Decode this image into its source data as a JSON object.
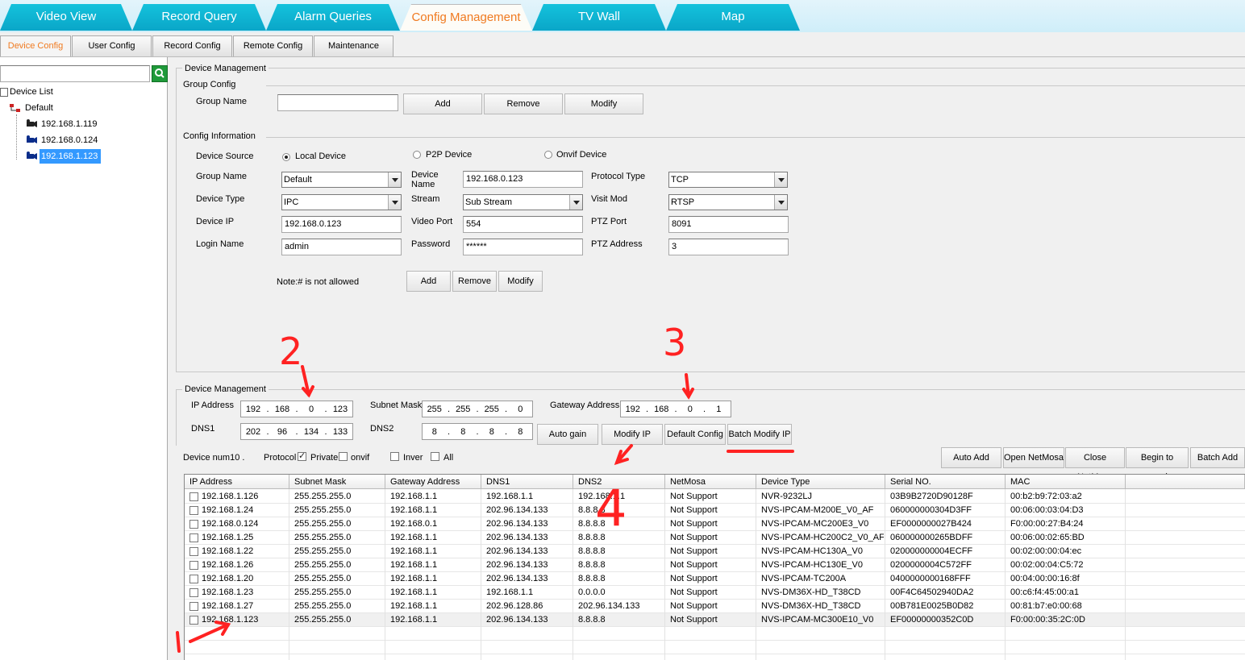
{
  "top_tabs": [
    "Video View",
    "Record Query",
    "Alarm Queries",
    "Config Management",
    "TV Wall",
    "Map"
  ],
  "sub_tabs": [
    "Device Config",
    "User Config",
    "Record Config",
    "Remote Config",
    "Maintenance"
  ],
  "tree": {
    "root": "Device List",
    "group": "Default",
    "devices": [
      "192.168.1.119",
      "192.168.0.124",
      "192.168.1.123"
    ]
  },
  "device_management_title": "Device Management",
  "group_config": {
    "title": "Group Config",
    "group_name_label": "Group Name",
    "group_name_value": "",
    "add": "Add",
    "remove": "Remove",
    "modify": "Modify"
  },
  "config_info": {
    "title": "Config Information",
    "device_source_label": "Device Source",
    "sources": [
      "Local Device",
      "P2P Device",
      "Onvif Device"
    ],
    "group_name_label": "Group Name",
    "group_name": "Default",
    "device_name_label": "Device Name",
    "device_name": "192.168.0.123",
    "protocol_type_label": "Protocol Type",
    "protocol_type": "TCP",
    "device_type_label": "Device Type",
    "device_type": "IPC",
    "stream_label": "Stream",
    "stream": "Sub Stream",
    "visit_mod_label": "Visit Mod",
    "visit_mod": "RTSP",
    "device_ip_label": "Device IP",
    "device_ip": "192.168.0.123",
    "video_port_label": "Video Port",
    "video_port": "554",
    "ptz_port_label": "PTZ Port",
    "ptz_port": "8091",
    "login_name_label": "Login Name",
    "login_name": "admin",
    "password_label": "Password",
    "password": "******",
    "ptz_address_label": "PTZ Address",
    "ptz_address": "3",
    "note": "Note:# is not allowed",
    "add": "Add",
    "remove": "Remove",
    "modify": "Modify"
  },
  "net": {
    "title": "Device Management",
    "ip_label": "IP Address",
    "ip": [
      "192",
      "168",
      "0",
      "123"
    ],
    "mask_label": "Subnet Mask",
    "mask": [
      "255",
      "255",
      "255",
      "0"
    ],
    "gw_label": "Gateway Address",
    "gw": [
      "192",
      "168",
      "0",
      "1"
    ],
    "dns1_label": "DNS1",
    "dns1": [
      "202",
      "96",
      "134",
      "133"
    ],
    "dns2_label": "DNS2",
    "dns2": [
      "8",
      "8",
      "8",
      "8"
    ],
    "auto_gain": "Auto gain",
    "modify_ip": "Modify IP",
    "default_config": "Default Config",
    "batch_modify_ip": "Batch Modify IP",
    "device_num": "Device num10 .",
    "protocol_label": "Protocol",
    "private_label": "Private",
    "onvif_label": "onvif",
    "inver_label": "Inver",
    "all_label": "All",
    "auto_add": "Auto Add",
    "open_netmosa": "Open NetMosa",
    "close_netmosa": "Close NetMosa",
    "begin_search": "Begin to search",
    "batch_add": "Batch Add"
  },
  "table": {
    "headers": [
      "IP Address",
      "Subnet Mask",
      "Gateway Address",
      "DNS1",
      "DNS2",
      "NetMosa",
      "Device Type",
      "Serial NO.",
      "MAC"
    ],
    "rows": [
      [
        "192.168.1.126",
        "255.255.255.0",
        "192.168.1.1",
        "192.168.1.1",
        "192.168.1.1",
        "Not Support",
        "NVR-9232LJ",
        "03B9B2720D90128F",
        "00:b2:b9:72:03:a2"
      ],
      [
        "192.168.1.24",
        "255.255.255.0",
        "192.168.1.1",
        "202.96.134.133",
        "8.8.8.8",
        "Not Support",
        "NVS-IPCAM-M200E_V0_AF",
        "060000000304D3FF",
        "00:06:00:03:04:D3"
      ],
      [
        "192.168.0.124",
        "255.255.255.0",
        "192.168.0.1",
        "202.96.134.133",
        "8.8.8.8",
        "Not Support",
        "NVS-IPCAM-MC200E3_V0",
        "EF0000000027B424",
        "F0:00:00:27:B4:24"
      ],
      [
        "192.168.1.25",
        "255.255.255.0",
        "192.168.1.1",
        "202.96.134.133",
        "8.8.8.8",
        "Not Support",
        "NVS-IPCAM-HC200C2_V0_AF",
        "060000000265BDFF",
        "00:06:00:02:65:BD"
      ],
      [
        "192.168.1.22",
        "255.255.255.0",
        "192.168.1.1",
        "202.96.134.133",
        "8.8.8.8",
        "Not Support",
        "NVS-IPCAM-HC130A_V0",
        "020000000004ECFF",
        "00:02:00:00:04:ec"
      ],
      [
        "192.168.1.26",
        "255.255.255.0",
        "192.168.1.1",
        "202.96.134.133",
        "8.8.8.8",
        "Not Support",
        "NVS-IPCAM-HC130E_V0",
        "0200000004C572FF",
        "00:02:00:04:C5:72"
      ],
      [
        "192.168.1.20",
        "255.255.255.0",
        "192.168.1.1",
        "202.96.134.133",
        "8.8.8.8",
        "Not Support",
        "NVS-IPCAM-TC200A",
        "0400000000168FFF",
        "00:04:00:00:16:8f"
      ],
      [
        "192.168.1.23",
        "255.255.255.0",
        "192.168.1.1",
        "192.168.1.1",
        "0.0.0.0",
        "Not Support",
        "NVS-DM36X-HD_T38CD",
        "00F4C64502940DA2",
        "00:c6:f4:45:00:a1"
      ],
      [
        "192.168.1.27",
        "255.255.255.0",
        "192.168.1.1",
        "202.96.128.86",
        "202.96.134.133",
        "Not Support",
        "NVS-DM36X-HD_T38CD",
        "00B781E0025B0D82",
        "00:81:b7:e0:00:68"
      ],
      [
        "192.168.1.123",
        "255.255.255.0",
        "192.168.1.1",
        "202.96.134.133",
        "8.8.8.8",
        "Not Support",
        "NVS-IPCAM-MC300E10_V0",
        "EF00000000352C0D",
        "F0:00:00:35:2C:0D"
      ]
    ]
  },
  "annotations": [
    "1",
    "2",
    "3",
    "4"
  ],
  "colors": {
    "tab_blue": "#0aa6c8",
    "active_orange": "#f07a20",
    "select_blue": "#3399ff",
    "annotation_red": "#ff2222"
  }
}
